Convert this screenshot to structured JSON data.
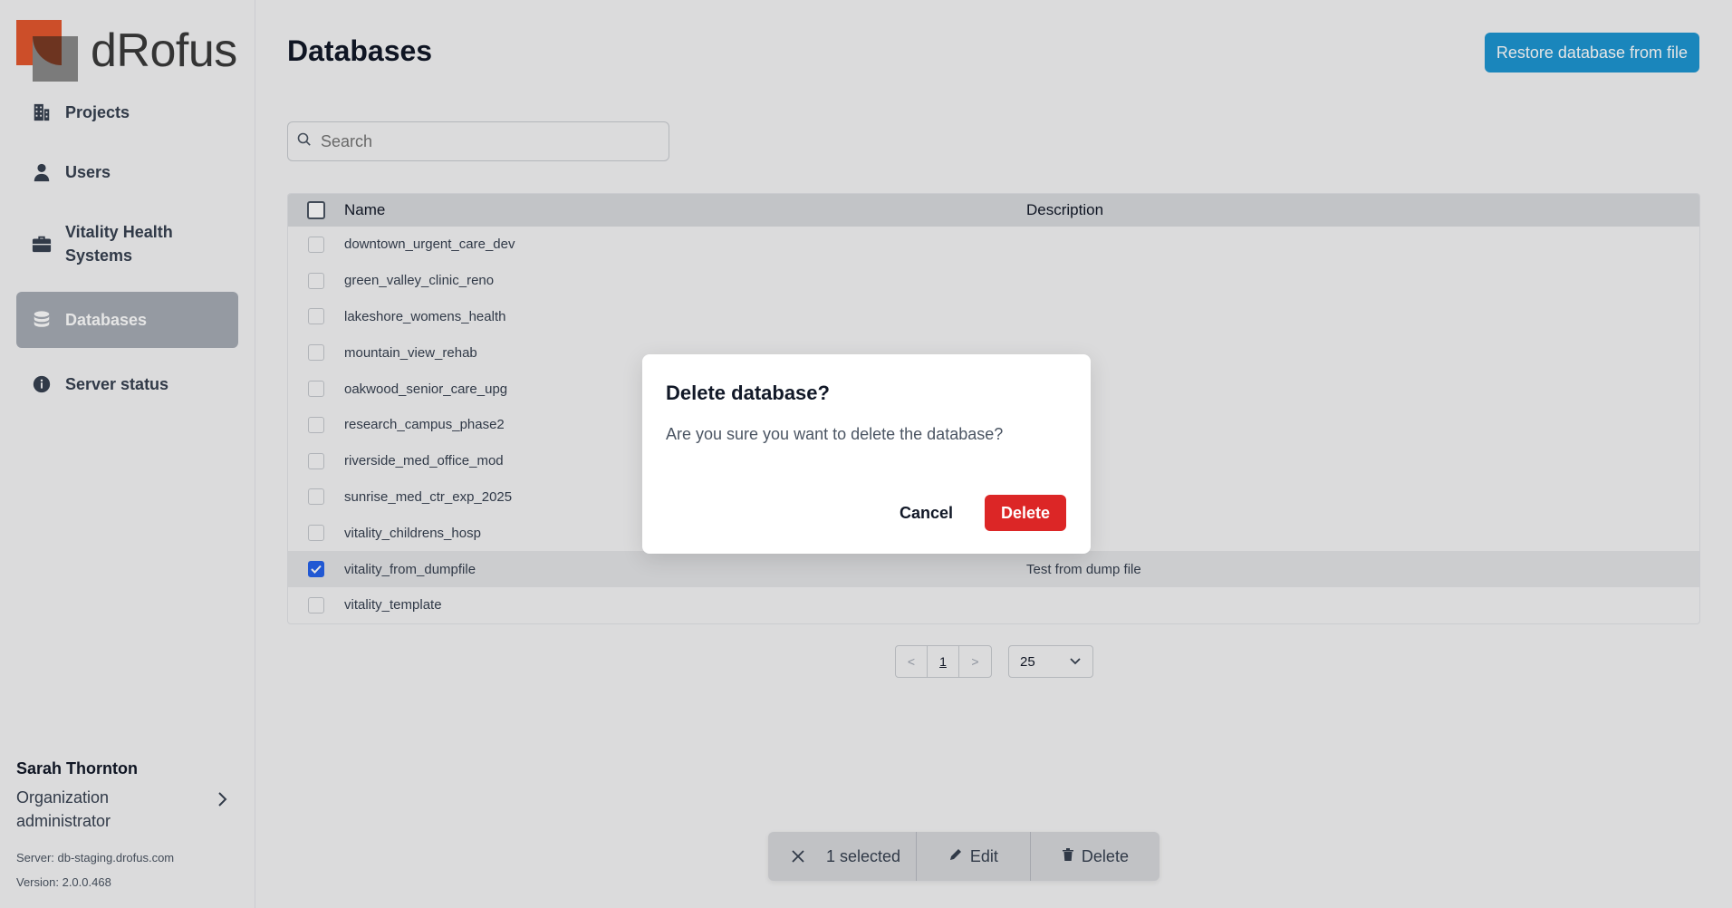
{
  "app": {
    "logo_text": "dRofus"
  },
  "sidebar": {
    "items": [
      {
        "label": "Projects",
        "icon": "building-icon"
      },
      {
        "label": "Users",
        "icon": "user-icon"
      },
      {
        "label": "Vitality Health Systems",
        "icon": "briefcase-icon"
      },
      {
        "label": "Databases",
        "icon": "database-icon",
        "active": true
      },
      {
        "label": "Server status",
        "icon": "info-icon"
      }
    ],
    "user": {
      "name": "Sarah Thornton",
      "role": "Organization administrator",
      "server": "Server: db-staging.drofus.com",
      "version": "Version: 2.0.0.468"
    }
  },
  "main": {
    "title": "Databases",
    "restore_label": "Restore database from file",
    "search": {
      "placeholder": "Search",
      "value": ""
    },
    "table": {
      "columns": [
        "Name",
        "Description"
      ],
      "rows": [
        {
          "name": "downtown_urgent_care_dev",
          "description": "",
          "checked": false
        },
        {
          "name": "green_valley_clinic_reno",
          "description": "",
          "checked": false
        },
        {
          "name": "lakeshore_womens_health",
          "description": "",
          "checked": false
        },
        {
          "name": "mountain_view_rehab",
          "description": "",
          "checked": false
        },
        {
          "name": "oakwood_senior_care_upg",
          "description": "",
          "checked": false
        },
        {
          "name": "research_campus_phase2",
          "description": "",
          "checked": false
        },
        {
          "name": "riverside_med_office_mod",
          "description": "",
          "checked": false
        },
        {
          "name": "sunrise_med_ctr_exp_2025",
          "description": "",
          "checked": false
        },
        {
          "name": "vitality_childrens_hosp",
          "description": "",
          "checked": false
        },
        {
          "name": "vitality_from_dumpfile",
          "description": "Test from dump file",
          "checked": true
        },
        {
          "name": "vitality_template",
          "description": "",
          "checked": false
        }
      ]
    },
    "pager": {
      "prev": "<",
      "page": "1",
      "next": ">",
      "page_size": "25"
    },
    "action_bar": {
      "selected": "1 selected",
      "edit": "Edit",
      "delete": "Delete"
    }
  },
  "modal": {
    "title": "Delete database?",
    "body": "Are you sure you want to delete the database?",
    "cancel": "Cancel",
    "confirm": "Delete"
  },
  "colors": {
    "accent": "#1e96d2",
    "danger": "#dc2626",
    "checkbox": "#2563eb",
    "logo_orange": "#e4572e"
  }
}
